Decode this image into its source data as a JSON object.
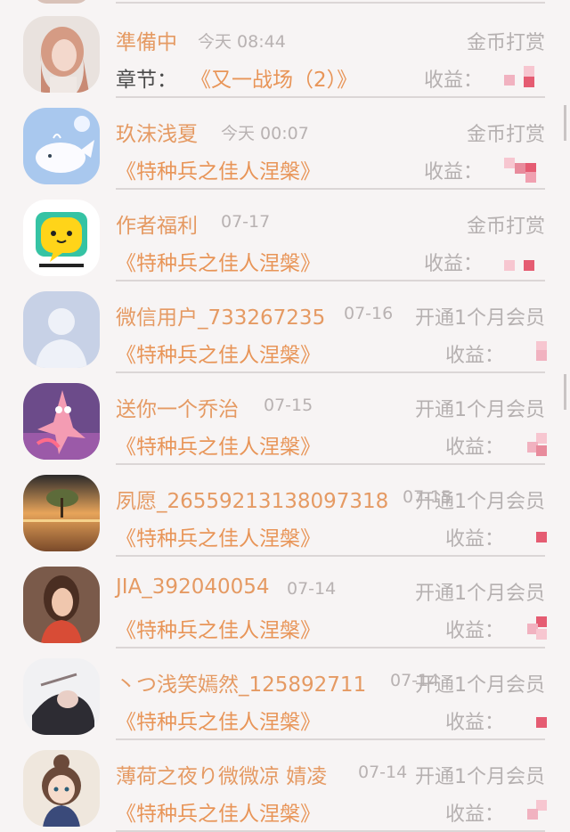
{
  "colors": {
    "name": "#e59a63",
    "book": "#e89558",
    "meta": "#b5b0b0",
    "chapter_label": "#4a4a4a",
    "background": "#f7f4f4"
  },
  "rows": [
    {
      "avatar": "girl-pink-hair-avatar",
      "name": "準備中",
      "date": "今天 08:44",
      "type": "金币打赏",
      "chapter_label": "章节：",
      "book": "《又一战场（2）》",
      "earn_label": "收益："
    },
    {
      "avatar": "whale-cartoon-avatar",
      "name": "玖沫浅夏",
      "date": "今天 00:07",
      "type": "金币打赏",
      "chapter_label": "",
      "book": "《特种兵之佳人涅槃》",
      "earn_label": "收益："
    },
    {
      "avatar": "yellow-chat-bubble-avatar",
      "name": "作者福利",
      "date": "07-17",
      "type": "金币打赏",
      "chapter_label": "",
      "book": "《特种兵之佳人涅槃》",
      "earn_label": "收益："
    },
    {
      "avatar": "default-user-avatar",
      "name": "微信用户_733267235",
      "date": "07-16",
      "type": "开通1个月会员",
      "chapter_label": "",
      "book": "《特种兵之佳人涅槃》",
      "earn_label": "收益："
    },
    {
      "avatar": "cartoon-starfish-avatar",
      "name": "送你一个乔治",
      "date": "07-15",
      "type": "开通1个月会员",
      "chapter_label": "",
      "book": "《特种兵之佳人涅槃》",
      "earn_label": "收益："
    },
    {
      "avatar": "sunset-tree-avatar",
      "name": "夙愿_26559213138097318",
      "date": "07-15",
      "type": "开通1个月会员",
      "chapter_label": "",
      "book": "《特种兵之佳人涅槃》",
      "earn_label": "收益："
    },
    {
      "avatar": "illustrated-woman-avatar",
      "name": "JIA_392040054",
      "date": "07-14",
      "type": "开通1个月会员",
      "chapter_label": "",
      "book": "《特种兵之佳人涅槃》",
      "earn_label": "收益："
    },
    {
      "avatar": "woman-photo-avatar",
      "name": "丶つ浅笑嫣然_125892711",
      "date": "07-14",
      "type": "开通1个月会员",
      "chapter_label": "",
      "book": "《特种兵之佳人涅槃》",
      "earn_label": "收益："
    },
    {
      "avatar": "anime-girl-avatar",
      "name": "薄荷之夜り微微凉 婧凌",
      "date": "07-14",
      "type": "开通1个月会员",
      "chapter_label": "",
      "book": "《特种兵之佳人涅槃》",
      "earn_label": "收益："
    }
  ]
}
